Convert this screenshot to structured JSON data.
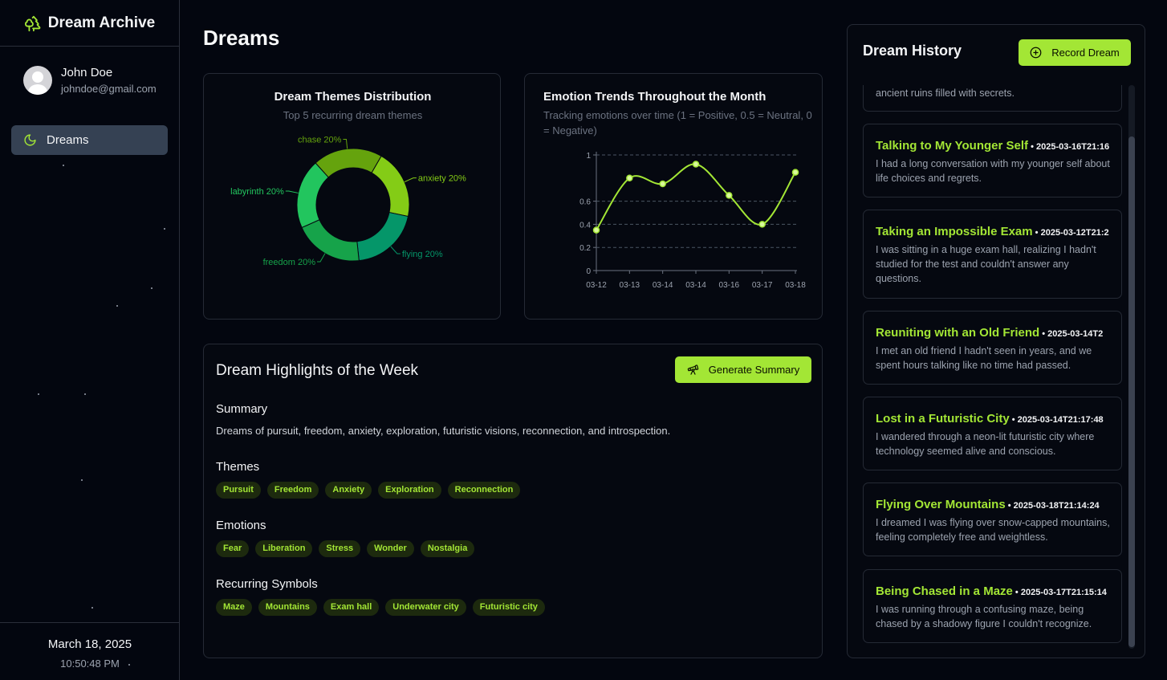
{
  "app": {
    "title": "Dream Archive"
  },
  "user": {
    "name": "John Doe",
    "email": "johndoe@gmail.com"
  },
  "nav": {
    "items": [
      {
        "label": "Dreams",
        "icon": "moon-icon"
      }
    ]
  },
  "footer": {
    "date": "March 18, 2025",
    "time": "10:50:48 PM"
  },
  "page": {
    "title": "Dreams"
  },
  "themes_chart": {
    "title": "Dream Themes Distribution",
    "subtitle": "Top 5 recurring dream themes",
    "chart_data": {
      "type": "pie",
      "categories": [
        "anxiety",
        "flying",
        "freedom",
        "labyrinth",
        "chase"
      ],
      "values": [
        20,
        20,
        20,
        20,
        20
      ],
      "labels": [
        "anxiety 20%",
        "flying 20%",
        "freedom 20%",
        "labyrinth 20%",
        "chase 20%"
      ],
      "colors": [
        "#84cc16",
        "#059669",
        "#16a34a",
        "#22c55e",
        "#65a30d"
      ]
    }
  },
  "emotion_chart": {
    "title": "Emotion Trends Throughout the Month",
    "subtitle": "Tracking emotions over time (1 = Positive, 0.5 = Neutral, 0 = Negative)",
    "chart_data": {
      "type": "line",
      "categories": [
        "03-12",
        "03-13",
        "03-14",
        "03-14",
        "03-16",
        "03-17",
        "03-18"
      ],
      "values": [
        0.35,
        0.8,
        0.75,
        0.92,
        0.65,
        0.4,
        0.85
      ],
      "ylim": [
        0,
        1
      ],
      "yticks": [
        "0",
        "0.2",
        "0.4",
        "0.6",
        "1"
      ],
      "grid": true,
      "line_color": "#a3e635"
    }
  },
  "highlights": {
    "title": "Dream Highlights of the Week",
    "generate_label": "Generate Summary",
    "summary_title": "Summary",
    "summary_text": "Dreams of pursuit, freedom, anxiety, exploration, futuristic visions, reconnection, and introspection.",
    "themes_title": "Themes",
    "themes": [
      "Pursuit",
      "Freedom",
      "Anxiety",
      "Exploration",
      "Reconnection"
    ],
    "emotions_title": "Emotions",
    "emotions": [
      "Fear",
      "Liberation",
      "Stress",
      "Wonder",
      "Nostalgia"
    ],
    "symbols_title": "Recurring Symbols",
    "symbols": [
      "Maze",
      "Mountains",
      "Exam hall",
      "Underwater city",
      "Futuristic city"
    ]
  },
  "history": {
    "title": "Dream History",
    "record_label": "Record Dream",
    "partial_desc": "ancient ruins filled with secrets.",
    "entries": [
      {
        "title": "Talking to My Younger Self",
        "date": "2025-03-16T21:16",
        "desc": "I had a long conversation with my younger self about life choices and regrets."
      },
      {
        "title": "Taking an Impossible Exam",
        "date": "2025-03-12T21:2",
        "desc": "I was sitting in a huge exam hall, realizing I hadn't studied for the test and couldn't answer any questions."
      },
      {
        "title": "Reuniting with an Old Friend",
        "date": "2025-03-14T2",
        "desc": "I met an old friend I hadn't seen in years, and we spent hours talking like no time had passed."
      },
      {
        "title": "Lost in a Futuristic City",
        "date": "2025-03-14T21:17:48",
        "desc": "I wandered through a neon-lit futuristic city where technology seemed alive and conscious."
      },
      {
        "title": "Flying Over Mountains",
        "date": "2025-03-18T21:14:24",
        "desc": "I dreamed I was flying over snow-capped mountains, feeling completely free and weightless."
      },
      {
        "title": "Being Chased in a Maze",
        "date": "2025-03-17T21:15:14",
        "desc": "I was running through a confusing maze, being chased by a shadowy figure I couldn't recognize."
      }
    ]
  }
}
